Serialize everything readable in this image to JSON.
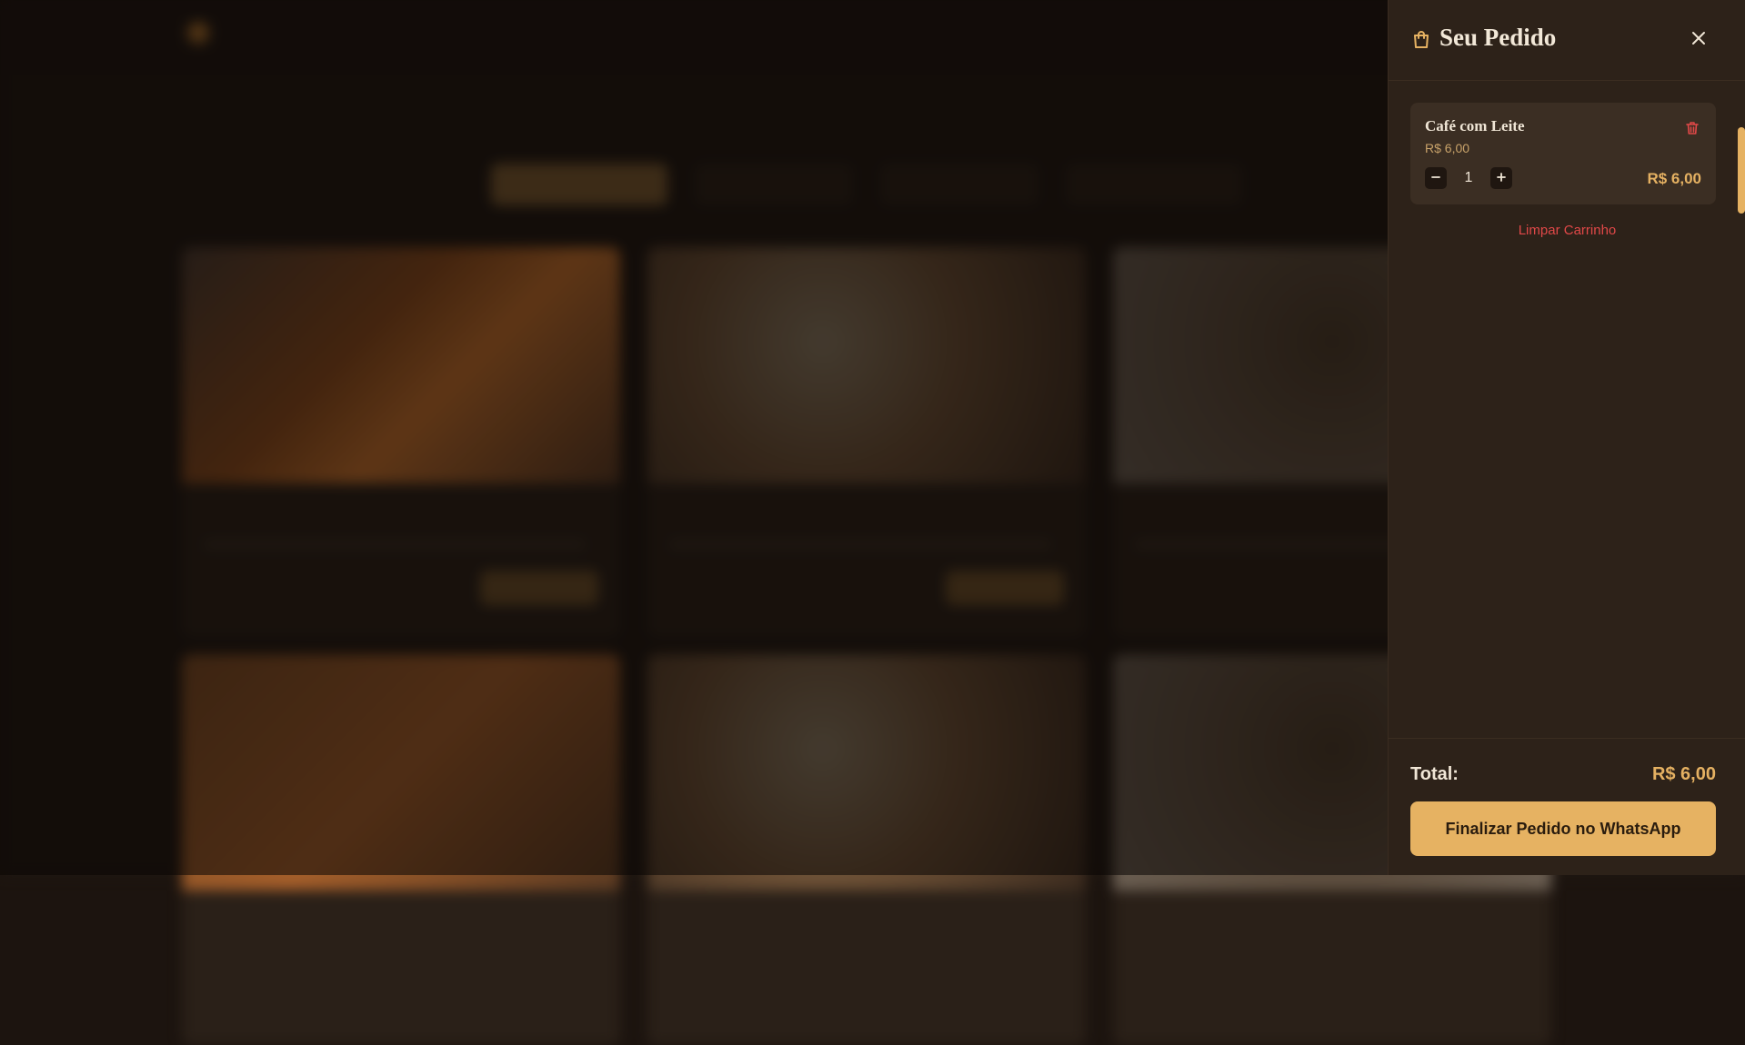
{
  "cart": {
    "title": "Seu Pedido",
    "items": [
      {
        "name": "Café com Leite",
        "unit_price": "R$ 6,00",
        "quantity": "1",
        "subtotal": "R$ 6,00"
      }
    ],
    "clear_label": "Limpar Carrinho",
    "total_label": "Total:",
    "total_value": "R$ 6,00",
    "checkout_label": "Finalizar Pedido no WhatsApp"
  },
  "colors": {
    "accent": "#e6b262",
    "danger": "#e04848",
    "drawer_bg": "#2d2219",
    "page_bg": "#1c140f"
  },
  "icons": {
    "bag": "shopping-bag-icon",
    "close": "close-icon",
    "trash": "trash-icon",
    "minus": "minus-icon",
    "plus": "plus-icon"
  }
}
